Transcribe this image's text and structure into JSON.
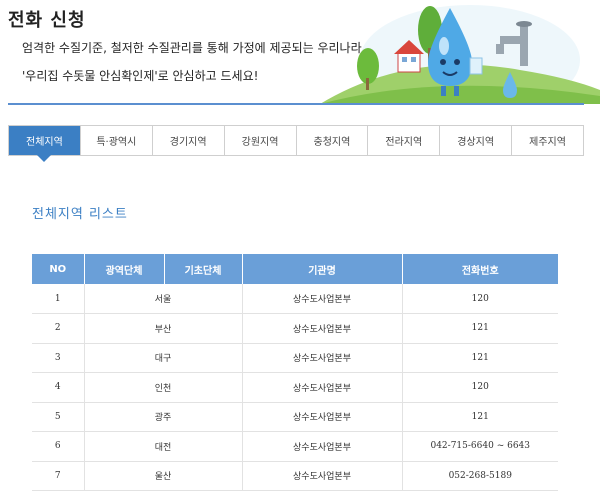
{
  "header": {
    "title": "전화 신청",
    "intro_line1": "엄격한 수질기준, 철저한 수질관리를 통해 가정에 제공되는 우리나라 수돗물,",
    "intro_line2": "'우리집 수돗물 안심확인제'로 안심하고 드세요!"
  },
  "tabs": [
    {
      "label": "전체지역",
      "active": true
    },
    {
      "label": "특·광역시",
      "active": false
    },
    {
      "label": "경기지역",
      "active": false
    },
    {
      "label": "강원지역",
      "active": false
    },
    {
      "label": "충청지역",
      "active": false
    },
    {
      "label": "전라지역",
      "active": false
    },
    {
      "label": "경상지역",
      "active": false
    },
    {
      "label": "제주지역",
      "active": false
    }
  ],
  "section_title": "전체지역 리스트",
  "table": {
    "headers": [
      "NO",
      "광역단체",
      "기초단체",
      "기관명",
      "전화번호"
    ],
    "rows": [
      {
        "no": "1",
        "region": "서울",
        "district": "",
        "org": "상수도사업본부",
        "phone": "120"
      },
      {
        "no": "2",
        "region": "부산",
        "district": "",
        "org": "상수도사업본부",
        "phone": "121"
      },
      {
        "no": "3",
        "region": "대구",
        "district": "",
        "org": "상수도사업본부",
        "phone": "121"
      },
      {
        "no": "4",
        "region": "인천",
        "district": "",
        "org": "상수도사업본부",
        "phone": "120"
      },
      {
        "no": "5",
        "region": "광주",
        "district": "",
        "org": "상수도사업본부",
        "phone": "121"
      },
      {
        "no": "6",
        "region": "대전",
        "district": "",
        "org": "상수도사업본부",
        "phone": "042-715-6640 ~ 6643"
      },
      {
        "no": "7",
        "region": "울산",
        "district": "",
        "org": "상수도사업본부",
        "phone": "052-268-5189"
      }
    ]
  },
  "colors": {
    "accent": "#3b7fc4",
    "header_row": "#6a9fd8",
    "title_line": "#5b8fd0"
  }
}
